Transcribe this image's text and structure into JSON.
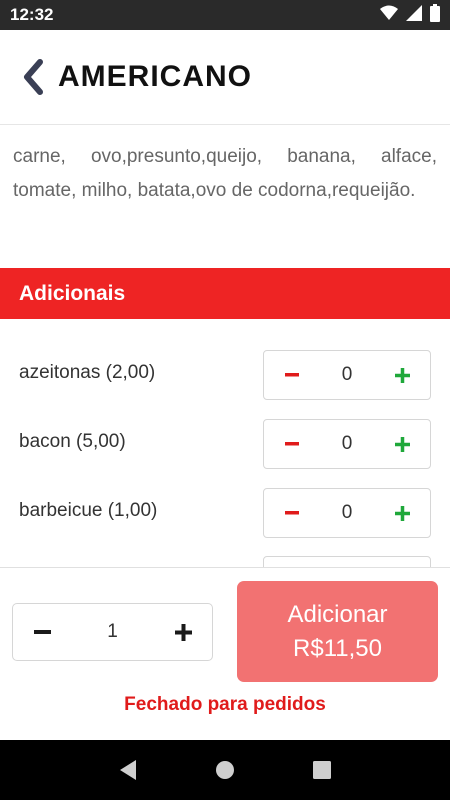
{
  "status_bar": {
    "time": "12:32"
  },
  "header": {
    "title": "AMERICANO"
  },
  "description": "carne, ovo,presunto,queijo, banana, alface, tomate, milho, batata,ovo de codorna,requeijão.",
  "addons": {
    "title": "Adicionais",
    "items": [
      {
        "label": "azeitonas (2,00)",
        "qty": "0"
      },
      {
        "label": "bacon (5,00)",
        "qty": "0"
      },
      {
        "label": "barbeicue (1,00)",
        "qty": "0"
      }
    ]
  },
  "footer": {
    "quantity": "1",
    "add_label": "Adicionar",
    "add_price": "R$11,50",
    "closed_message": "Fechado para pedidos"
  },
  "colors": {
    "brand_red": "#ee2424",
    "button_disabled": "#f27272",
    "minus": "#e01b1b",
    "plus": "#1fa83a"
  }
}
